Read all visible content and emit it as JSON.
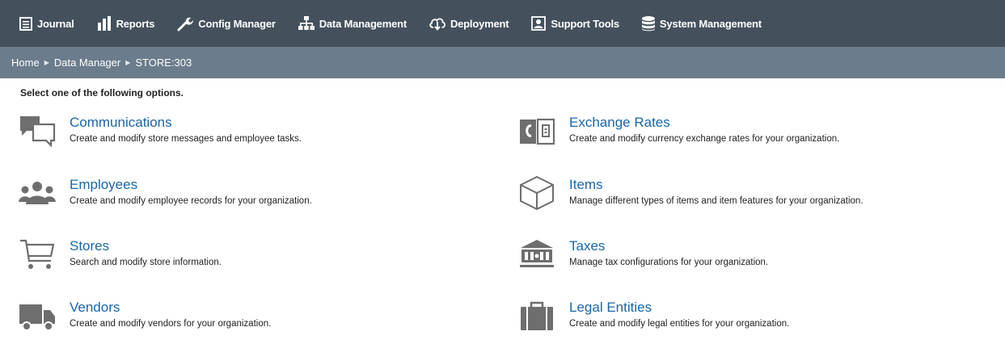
{
  "topnav": {
    "items": [
      {
        "label": "Journal",
        "icon": "journal-icon"
      },
      {
        "label": "Reports",
        "icon": "bar-chart-icon"
      },
      {
        "label": "Config Manager",
        "icon": "wrench-icon"
      },
      {
        "label": "Data Management",
        "icon": "org-chart-icon"
      },
      {
        "label": "Deployment",
        "icon": "cloud-download-icon"
      },
      {
        "label": "Support Tools",
        "icon": "support-person-icon"
      },
      {
        "label": "System Management",
        "icon": "database-icon"
      }
    ]
  },
  "breadcrumb": {
    "home": "Home",
    "data_manager": "Data Manager",
    "current": "STORE:303"
  },
  "instruction": "Select one of the following options.",
  "options": {
    "communications": {
      "title": "Communications",
      "description": "Create and modify store messages and employee tasks.",
      "icon": "chat-bubbles-icon"
    },
    "employees": {
      "title": "Employees",
      "description": "Create and modify employee records for your organization.",
      "icon": "people-group-icon"
    },
    "stores": {
      "title": "Stores",
      "description": "Search and modify store information.",
      "icon": "shopping-cart-icon"
    },
    "vendors": {
      "title": "Vendors",
      "description": "Create and modify vendors for your organization.",
      "icon": "delivery-truck-icon"
    },
    "exchange_rates": {
      "title": "Exchange Rates",
      "description": "Create and modify currency exchange rates for your organization.",
      "icon": "currency-exchange-icon"
    },
    "items": {
      "title": "Items",
      "description": "Manage different types of items and item features for your organization.",
      "icon": "cube-icon"
    },
    "taxes": {
      "title": "Taxes",
      "description": "Manage tax configurations for your organization.",
      "icon": "bank-building-icon"
    },
    "legal_entities": {
      "title": "Legal Entities",
      "description": "Create and modify legal entities for your organization.",
      "icon": "briefcase-icon"
    }
  },
  "colors": {
    "topnav_bg": "#44515d",
    "breadcrumb_bg": "#6b7c8c",
    "link": "#1a66a8",
    "icon_gray": "#6e6e6e"
  }
}
